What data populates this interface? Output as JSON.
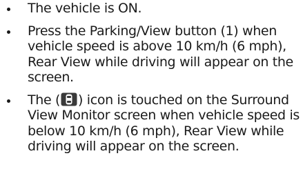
{
  "bullets": [
    {
      "text": "The vehicle is ON."
    },
    {
      "text": "Press the Parking/View button (1) when vehicle speed is above 10 km/h (6 mph), Rear View while driving will appear on the screen."
    },
    {
      "prefix": "The (",
      "icon": "surround-view-car-icon",
      "suffix": ") icon is touched on the Surround View Monitor screen when vehicle speed is below 10 km/h (6 mph), Rear View while driving will appear on the screen."
    }
  ]
}
